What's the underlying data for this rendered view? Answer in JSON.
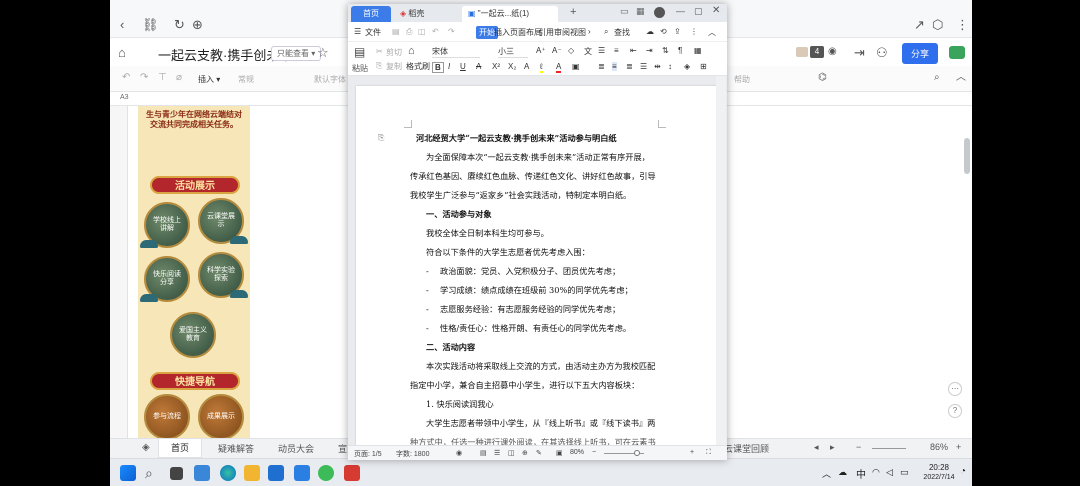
{
  "background_app": {
    "doc_title": "一起云支教·携手创未来",
    "mode_badge": "只能查看 ▾",
    "user_count": "4",
    "share_label": "分享",
    "insert_label": "插入 ▾",
    "normal_label": "常规",
    "default_font": "默认字体",
    "cell_ref": "A3",
    "right_toolbar_label": "帮助",
    "poster": {
      "head_text": "生与青少年在网络云端结对交流共同完成相关任务。",
      "banner1": "活动展示",
      "banner2": "快捷导航",
      "circles": [
        "学校线上讲解",
        "云课堂展示",
        "快乐阅读分享",
        "科学实验探索",
        "爱国主义教育"
      ],
      "bottom_circles": [
        "参与流程",
        "成果展示"
      ]
    },
    "sheet_tabs": [
      "首页",
      "疑难解答",
      "动员大会",
      "宣"
    ],
    "right_tab": "云课堂回顾",
    "zoom": "86%"
  },
  "wps": {
    "tabs": {
      "home": "首页",
      "daoke": "稻壳",
      "doc": "\"一起云...纸(1)"
    },
    "menu": {
      "file": "文件",
      "start": "开始",
      "insert": "插入",
      "layout": "页面布局",
      "ref": "引用",
      "review": "审阅",
      "view": "视图",
      "search": "查找"
    },
    "ribbon": {
      "cut": "剪切",
      "copy": "复制",
      "paste": "粘贴",
      "format_painter": "格式刷",
      "font": "宋体",
      "size": "小三"
    },
    "document": {
      "title": "河北经贸大学“一起云支教·携手创未来”活动参与明白纸",
      "p1": [
        "为全面保障本次“一起云支教·携手创未来”活动正常有序开展，",
        "传承红色基因、赓续红色血脉、传递红色文化、讲好红色故事，引导",
        "我校学生广泛参与“返家乡”社会实践活动，特制定本明白纸。"
      ],
      "s1_title": "一、活动参与对象",
      "s1_lines": [
        "我校全体全日制本科生均可参与。",
        "符合以下条件的大学生志愿者优先考虑入围："
      ],
      "bullets": [
        "政治面貌：党员、入党积极分子、团员优先考虑；",
        "学习成绩：绩点成绩在班级前 30%的同学优先考虑；",
        "志愿服务经验：有志愿服务经验的同学优先考虑；",
        "性格/责任心：性格开朗、有责任心的同学优先考虑。"
      ],
      "s2_title": "二、活动内容",
      "p2": [
        "本次实践活动将采取线上交流的方式，由活动主办方为我校匹配",
        "指定中小学，兼合自主招募中小学生，进行以下五大内容板块："
      ],
      "item1": "1. 快乐阅读润我心",
      "p3": [
        "大学生志愿者带领中小学生，从『线上听书』或『线下读书』两",
        "种方式中，任选一种进行课外阅读，在其选择线上听书，可在云素书"
      ]
    },
    "status": {
      "page": "页面: 1/5",
      "words": "字数: 1800",
      "zoom": "80%"
    }
  },
  "taskbar": {
    "ime": "中",
    "time": "20:28",
    "date": "2022/7/14"
  }
}
